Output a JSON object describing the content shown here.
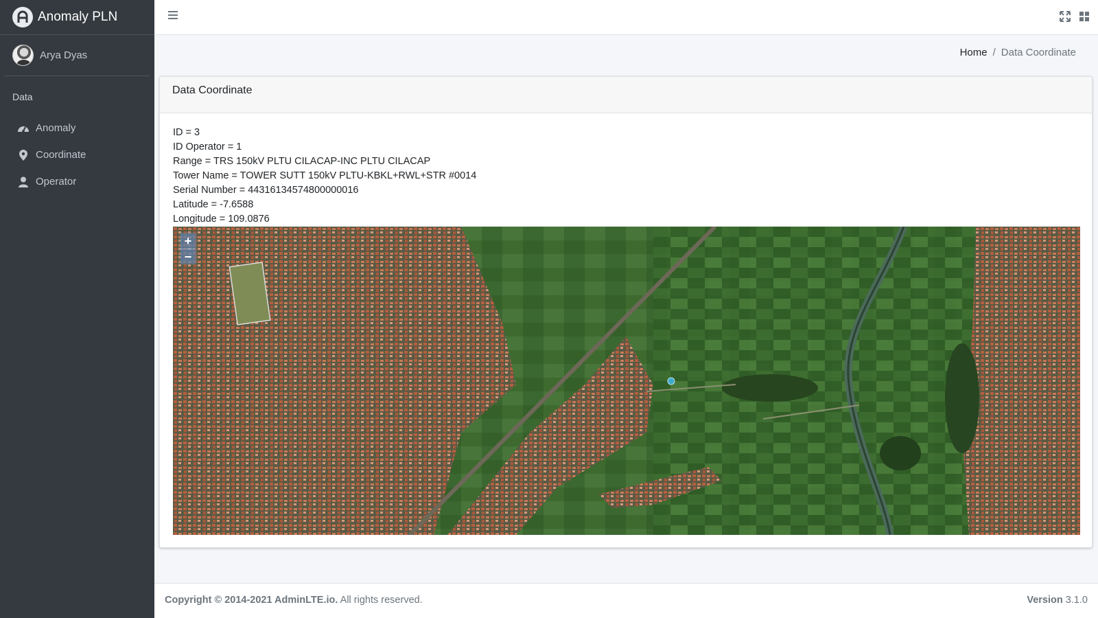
{
  "brand": {
    "title": "Anomaly PLN",
    "logo_letter": "A"
  },
  "user": {
    "name": "Arya Dyas"
  },
  "sidebar": {
    "header": "Data",
    "items": [
      {
        "label": "Anomaly",
        "icon": "tachometer-icon"
      },
      {
        "label": "Coordinate",
        "icon": "map-marker-icon"
      },
      {
        "label": "Operator",
        "icon": "user-icon"
      }
    ]
  },
  "breadcrumb": {
    "home": "Home",
    "separator": "/",
    "current": "Data Coordinate"
  },
  "card": {
    "title": "Data Coordinate",
    "fields": [
      "ID = 3",
      "ID Operator = 1",
      "Range = TRS 150kV PLTU CILACAP-INC PLTU CILACAP",
      "Tower Name = TOWER SUTT 150kV PLTU-KBKL+RWL+STR #0014",
      "Serial Number = 443161345748000000​16",
      "Latitude = -7.6588",
      "Longitude = 109.0876"
    ]
  },
  "map": {
    "zoom_in": "+",
    "zoom_out": "−",
    "marker_color": "#3fa9c9"
  },
  "footer": {
    "copyright_prefix": "Copyright © 2014-2021 ",
    "copyright_link": "AdminLTE.io.",
    "copyright_suffix": " All rights reserved.",
    "version_label": "Version",
    "version_value": " 3.1.0"
  },
  "colors": {
    "sidebar_bg": "#343a40",
    "content_bg": "#f4f6f9",
    "card_header_bg": "#f7f7f7"
  }
}
